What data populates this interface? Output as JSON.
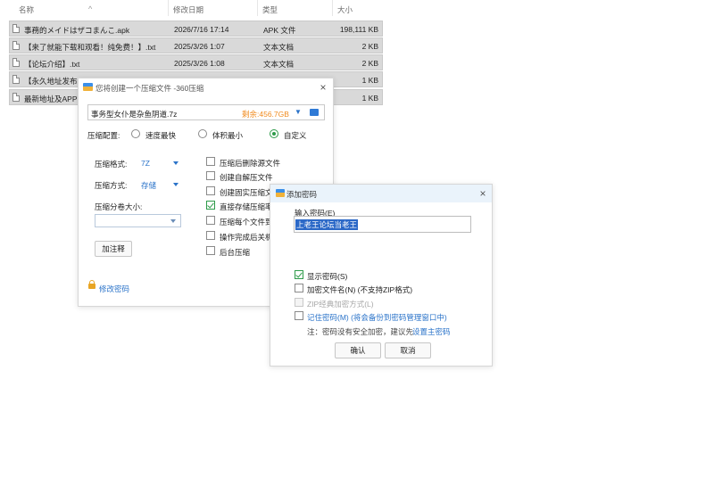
{
  "explorer": {
    "columns": {
      "name": "名称",
      "date": "修改日期",
      "type": "类型",
      "size": "大小"
    },
    "rows": [
      {
        "name": "事務的メイドはザコまんこ.apk",
        "date": "2026/7/16 17:14",
        "type": "APK 文件",
        "size": "198,111 KB"
      },
      {
        "name": "【来了就能下载和观看！纯免费！】.txt",
        "date": "2025/3/26 1:07",
        "type": "文本文档",
        "size": "2 KB"
      },
      {
        "name": "【论坛介绍】.txt",
        "date": "2025/3/26 1:08",
        "type": "文本文档",
        "size": "2 KB"
      },
      {
        "name": "【永久地址发布",
        "date": "",
        "type": "",
        "size": "1 KB"
      },
      {
        "name": "最新地址及APP",
        "date": "",
        "type": "",
        "size": "1 KB"
      }
    ]
  },
  "zip_dialog": {
    "title": "您将创建一个压缩文件 -360压缩",
    "filename": "事务型女仆是杂鱼阴道.7z",
    "free_space": "剩余:456.7GB",
    "config_label": "压缩配置:",
    "modes": [
      "速度最快",
      "体积最小",
      "自定义"
    ],
    "selected_mode": "自定义",
    "format_label": "压缩格式:",
    "format_value": "7Z",
    "method_label": "压缩方式:",
    "method_value": "存储",
    "volume_label": "压缩分卷大小:",
    "volume_value": "",
    "comment_button": "加注释",
    "options": [
      {
        "label": "压缩后删除源文件",
        "checked": false
      },
      {
        "label": "创建自解压文件",
        "checked": false
      },
      {
        "label": "创建固实压缩文",
        "checked": false
      },
      {
        "label": "直接存储压缩率",
        "checked": true
      },
      {
        "label": "压缩每个文件到",
        "checked": false
      },
      {
        "label": "操作完成后关机",
        "checked": false
      },
      {
        "label": "后台压缩",
        "checked": false
      }
    ],
    "change_password_link": "修改密码"
  },
  "password_dialog": {
    "title": "添加密码",
    "input_label": "输入密码(E)",
    "password_value": "上老王论坛当老王",
    "options": [
      {
        "label": "显示密码(S)",
        "checked": true,
        "disabled": false
      },
      {
        "label": "加密文件名(N) (不支持ZIP格式)",
        "checked": false,
        "disabled": false
      },
      {
        "label": "ZIP经典加密方式(L)",
        "checked": false,
        "disabled": true
      },
      {
        "label": "记住密码(M) (将会备份到密码管理窗口中)",
        "checked": false,
        "disabled": false
      }
    ],
    "note_prefix": "注：密码没有安全加密，建议先",
    "note_link": "设置主密码",
    "ok_button": "确认",
    "cancel_button": "取消"
  },
  "colors": {
    "accent_blue": "#2a73c9",
    "orange": "#f08a1d",
    "check_green": "#2e9b4a",
    "row_selected": "#d9d9d9"
  }
}
